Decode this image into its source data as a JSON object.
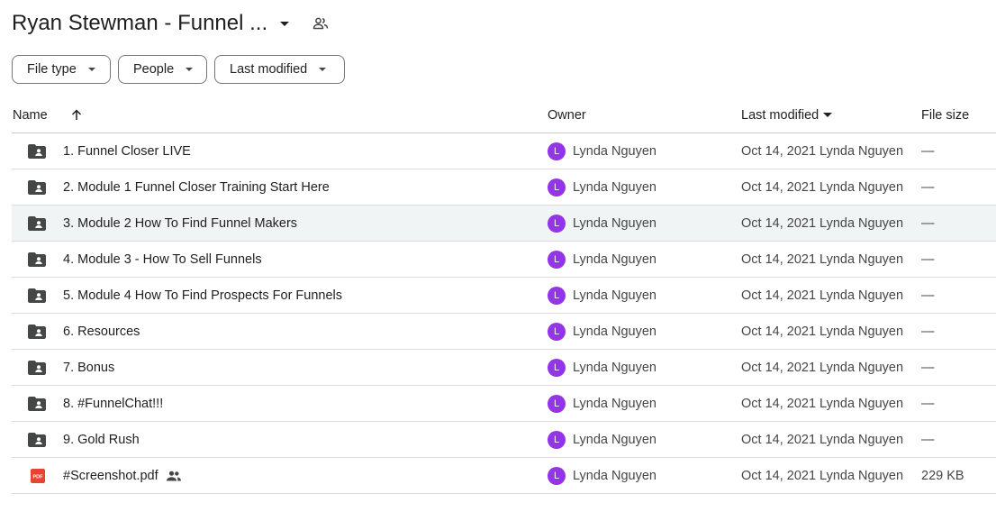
{
  "header": {
    "title": "Ryan Stewman - Funnel ..."
  },
  "filters": [
    {
      "label": "File type"
    },
    {
      "label": "People"
    },
    {
      "label": "Last modified"
    }
  ],
  "columns": {
    "name": "Name",
    "owner": "Owner",
    "last_modified": "Last modified",
    "file_size": "File size"
  },
  "rows": [
    {
      "name": "1. Funnel Closer LIVE",
      "type": "shared-folder",
      "owner_initial": "L",
      "owner": "Lynda Nguyen",
      "modified": "Oct 14, 2021 Lynda Nguyen",
      "size": "—"
    },
    {
      "name": "2. Module 1 Funnel Closer Training Start Here",
      "type": "shared-folder",
      "owner_initial": "L",
      "owner": "Lynda Nguyen",
      "modified": "Oct 14, 2021 Lynda Nguyen",
      "size": "—"
    },
    {
      "name": "3. Module 2 How To Find Funnel Makers",
      "type": "shared-folder",
      "owner_initial": "L",
      "owner": "Lynda Nguyen",
      "modified": "Oct 14, 2021 Lynda Nguyen",
      "size": "—"
    },
    {
      "name": "4. Module 3 - How To Sell Funnels",
      "type": "shared-folder",
      "owner_initial": "L",
      "owner": "Lynda Nguyen",
      "modified": "Oct 14, 2021 Lynda Nguyen",
      "size": "—"
    },
    {
      "name": "5. Module 4 How To Find Prospects For Funnels",
      "type": "shared-folder",
      "owner_initial": "L",
      "owner": "Lynda Nguyen",
      "modified": "Oct 14, 2021 Lynda Nguyen",
      "size": "—"
    },
    {
      "name": "6. Resources",
      "type": "shared-folder",
      "owner_initial": "L",
      "owner": "Lynda Nguyen",
      "modified": "Oct 14, 2021 Lynda Nguyen",
      "size": "—"
    },
    {
      "name": "7. Bonus",
      "type": "shared-folder",
      "owner_initial": "L",
      "owner": "Lynda Nguyen",
      "modified": "Oct 14, 2021 Lynda Nguyen",
      "size": "—"
    },
    {
      "name": "8. #FunnelChat!!!",
      "type": "shared-folder",
      "owner_initial": "L",
      "owner": "Lynda Nguyen",
      "modified": "Oct 14, 2021 Lynda Nguyen",
      "size": "—"
    },
    {
      "name": "9. Gold Rush",
      "type": "shared-folder",
      "owner_initial": "L",
      "owner": "Lynda Nguyen",
      "modified": "Oct 14, 2021 Lynda Nguyen",
      "size": "—"
    },
    {
      "name": "#Screenshot.pdf",
      "type": "pdf",
      "pdf_label": "PDF",
      "owner_initial": "L",
      "owner": "Lynda Nguyen",
      "modified": "Oct 14, 2021 Lynda Nguyen",
      "size": "229 KB"
    }
  ],
  "colors": {
    "avatar": "#9334e6",
    "pdf": "#ea4335",
    "folder": "#444746",
    "hover_row": "#f0f4f4"
  }
}
